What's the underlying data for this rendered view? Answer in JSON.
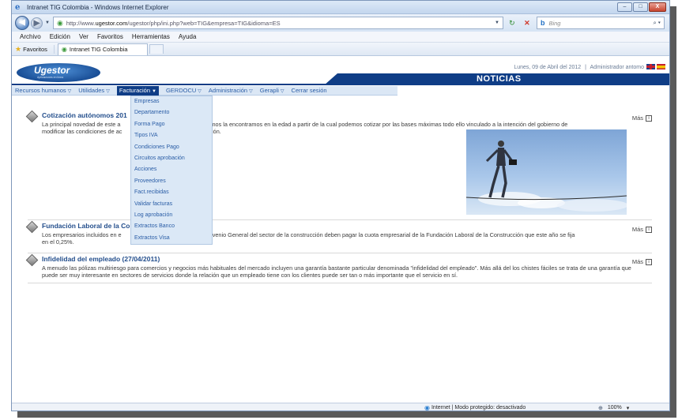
{
  "window": {
    "title": "Intranet TIG Colombia - Windows Internet Explorer",
    "buttons": {
      "minimize": "–",
      "maximize": "□",
      "close": "X"
    }
  },
  "addressbar": {
    "url_prefix": "http://www.",
    "url_domain": "ugestor.com",
    "url_rest": "/ugestor/php/ini.php?web=TIG&empresa=TIG&idioma=ES",
    "search_placeholder": "Bing"
  },
  "menubar": [
    "Archivo",
    "Edición",
    "Ver",
    "Favoritos",
    "Herramientas",
    "Ayuda"
  ],
  "favbar": {
    "favorites_label": "Favoritos",
    "tab_label": "Intranet TIG Colombia"
  },
  "header": {
    "logo": "Ugestor",
    "logo_sub": "Aplicaciones en línea",
    "date": "Lunes, 09 de Abril del 2012",
    "separator": "|",
    "user": "Administrador antomo",
    "section_title": "NOTICIAS"
  },
  "nav": [
    {
      "label": "Recursos humanos",
      "arrow": "▽"
    },
    {
      "label": "Utilidades",
      "arrow": "▽"
    },
    {
      "label": "Facturación",
      "arrow": "▼"
    },
    {
      "label": "GERDOCU",
      "arrow": "▽"
    },
    {
      "label": "Administración",
      "arrow": "▽"
    },
    {
      "label": "Gerapli",
      "arrow": "▽"
    },
    {
      "label": "Cerrar sesión",
      "arrow": ""
    }
  ],
  "dropdown": [
    "Empresas",
    "Departamento",
    "Forma Pago",
    "Tipos IVA",
    "Condiciones Pago",
    "Circuitos aprobación",
    "Acciones",
    "Proveedores",
    "Fact.recibidas",
    "Validar facturas",
    "Log aprobación",
    "Extractos Banco",
    "Extractos Visa"
  ],
  "news": [
    {
      "title": "Cotización autónomos 201",
      "body_left": "La principal novedad de este a",
      "body_right": "omos la encontramos en la edad a partir de la cual podemos cotizar por las bases máximas todo ello vinculado a la intención del gobierno de",
      "body_line2_left": "modificar las condiciones de ac",
      "body_line2_right": "ción.",
      "more": "Más"
    },
    {
      "title": "Fundación Laboral de la Co",
      "title_tail": ")",
      "body_left": "Los empresarios incluidos en e",
      "body_right": "onvenio General del sector de la construcción deben pagar la cuota empresarial de la Fundación Laboral de la Construcción que este año se fija",
      "body_line2_left": "en el 0,25%.",
      "body_line2_right": "",
      "more": "Más"
    },
    {
      "title": "Infidelidad del empleado (27/04/2011)",
      "body": "A menudo las pólizas multiriesgo para comercios y negocios más habituales del mercado incluyen una garantía bastante particular denominada \"infidelidad del empleado\". Más allá del los chistes fáciles se trata de una garantía que puede ser muy interesante en sectores de servicios donde la relación que un empleado tiene con los clientes puede ser tan o más importante que el servicio en sí.",
      "more": "Más"
    }
  ],
  "statusbar": {
    "zone": "Internet | Modo protegido: desactivado",
    "zoom": "100%"
  },
  "colors": {
    "accent": "#0f3d86",
    "link": "#2a5da6",
    "menu_bg": "#dbe8f6"
  }
}
